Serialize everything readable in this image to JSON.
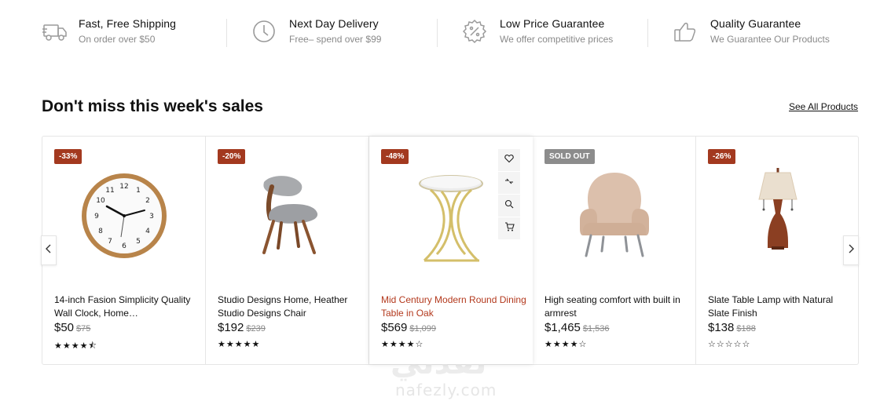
{
  "features": [
    {
      "icon": "truck-icon",
      "title": "Fast, Free Shipping",
      "subtitle": "On order over $50"
    },
    {
      "icon": "clock-icon",
      "title": "Next Day Delivery",
      "subtitle": "Free– spend over $99"
    },
    {
      "icon": "discount-badge-icon",
      "title": "Low Price Guarantee",
      "subtitle": "We offer competitive prices"
    },
    {
      "icon": "thumbs-up-icon",
      "title": "Quality Guarantee",
      "subtitle": "We Guarantee Our Products"
    }
  ],
  "section": {
    "title": "Don't miss this week's sales",
    "see_all": "See All Products"
  },
  "products": [
    {
      "badge": "-33%",
      "name": "14-inch Fasion Simplicity Quality Wall Clock, Home…",
      "price": "$50",
      "old_price": "$75",
      "rating": "★★★★⯪",
      "rating_value": 4.5,
      "image": "wall-clock"
    },
    {
      "badge": "-20%",
      "name": "Studio Designs Home, Heather Studio Designs Chair",
      "price": "$192",
      "old_price": "$239",
      "rating": "★★★★★",
      "rating_value": 5,
      "image": "accent-chair"
    },
    {
      "badge": "-48%",
      "name": "Mid Century Modern Round Dining Table in Oak",
      "price": "$569",
      "old_price": "$1,099",
      "rating": "★★★★☆",
      "rating_value": 4,
      "image": "side-table"
    },
    {
      "badge": "SOLD OUT",
      "name": "High seating comfort with built in armrest",
      "price": "$1,465",
      "old_price": "$1,536",
      "rating": "★★★★☆",
      "rating_value": 4,
      "image": "armchair"
    },
    {
      "badge": "-26%",
      "name": "Slate Table Lamp with Natural Slate Finish",
      "price": "$138",
      "old_price": "$188",
      "rating": "☆☆☆☆☆",
      "rating_value": 0,
      "image": "table-lamp"
    }
  ],
  "card_actions": [
    "heart-icon",
    "compare-icon",
    "zoom-icon",
    "cart-icon"
  ],
  "colors": {
    "accent": "#a3391f",
    "highlight_text": "#b3391d",
    "sold_out": "#8c8c8c"
  },
  "watermark": {
    "arabic": "نفذلي",
    "latin": "nafezly.com"
  }
}
